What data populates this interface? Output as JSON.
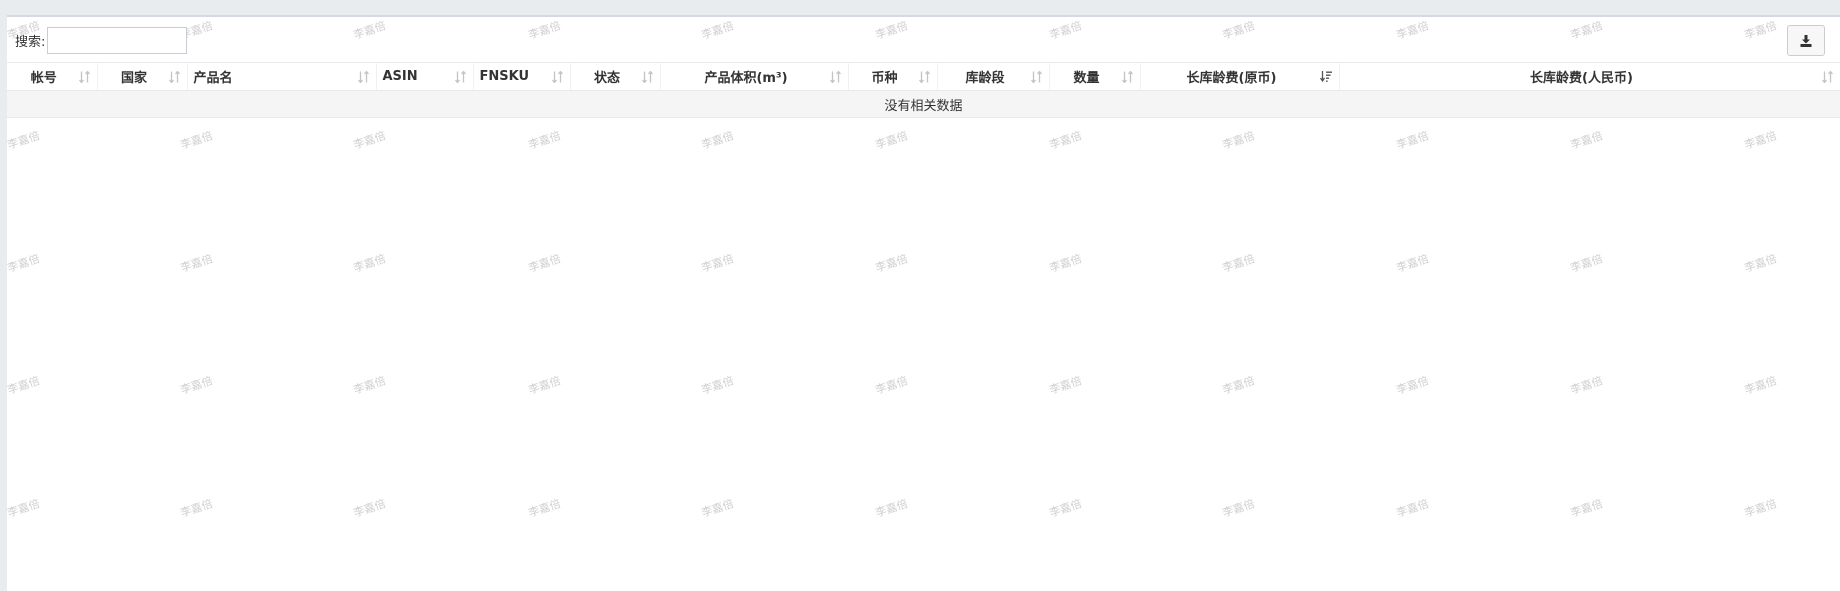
{
  "search": {
    "label": "搜索:",
    "value": "",
    "placeholder": ""
  },
  "toolbar": {
    "export_icon": "download-icon"
  },
  "watermark": "李嘉倍",
  "table": {
    "columns": [
      {
        "label": "帐号",
        "align": "center",
        "sort": "unsorted"
      },
      {
        "label": "国家",
        "align": "center",
        "sort": "unsorted"
      },
      {
        "label": "产品名",
        "align": "left",
        "sort": "unsorted"
      },
      {
        "label": "ASIN",
        "align": "left",
        "sort": "unsorted"
      },
      {
        "label": "FNSKU",
        "align": "left",
        "sort": "unsorted"
      },
      {
        "label": "状态",
        "align": "center",
        "sort": "unsorted"
      },
      {
        "label": "产品体积(m³)",
        "align": "center",
        "sort": "unsorted"
      },
      {
        "label": "币种",
        "align": "center",
        "sort": "unsorted"
      },
      {
        "label": "库龄段",
        "align": "center",
        "sort": "unsorted"
      },
      {
        "label": "数量",
        "align": "center",
        "sort": "unsorted"
      },
      {
        "label": "长库龄费(原币)",
        "align": "center",
        "sort": "descending"
      },
      {
        "label": "长库龄费(人民币)",
        "align": "center",
        "sort": "unsorted"
      }
    ],
    "empty_message": "没有相关数据"
  },
  "colors": {
    "page_bg": "#e9ecef",
    "panel_bg": "#ffffff",
    "empty_row_bg": "#f5f5f5",
    "watermark": "#cfcfcf"
  }
}
